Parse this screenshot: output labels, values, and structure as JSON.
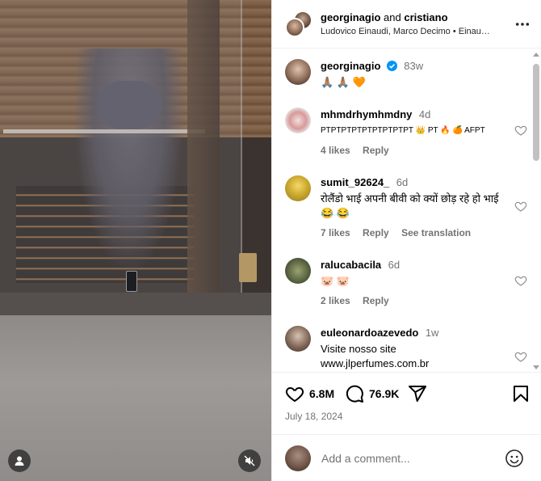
{
  "header": {
    "user1": "georginagio",
    "joiner": "and",
    "user2": "cristiano",
    "audio": "Ludovico Einaudi, Marco Decimo • Einau…"
  },
  "caption": {
    "username": "georginagio",
    "age": "83w",
    "text": "🙏🏽 🙏🏽 🧡"
  },
  "comments": [
    {
      "username": "mhmdrhymhmdny",
      "age": "4d",
      "text": "PTPTPTPTPTPTPTPTPT 👑 PT 🔥 🍊 AFPT",
      "likes": "4 likes",
      "reply": "Reply"
    },
    {
      "username": "sumit_92624_",
      "age": "6d",
      "text": "रोलैंडो भाई अपनी बीवी को क्यों छोड़ रहे हो भाई 😂 😂",
      "likes": "7 likes",
      "reply": "Reply",
      "translate": "See translation"
    },
    {
      "username": "ralucabacila",
      "age": "6d",
      "text": "🐷 🐷",
      "likes": "2 likes",
      "reply": "Reply"
    },
    {
      "username": "euleonardoazevedo",
      "age": "1w",
      "text": "Visite nosso site www.jlperfumes.com.br"
    }
  ],
  "stats": {
    "likes": "6.8M",
    "comments": "76.9K",
    "date": "July 18, 2024"
  },
  "compose": {
    "placeholder": "Add a comment..."
  },
  "icons": [
    "user-icon",
    "mute-icon",
    "more-icon",
    "verified-icon",
    "heart-icon",
    "comment-icon",
    "share-icon",
    "bookmark-icon",
    "emoji-icon"
  ],
  "colors": {
    "verified": "#0095f6",
    "muted_text": "#737373",
    "border": "#efefef"
  }
}
